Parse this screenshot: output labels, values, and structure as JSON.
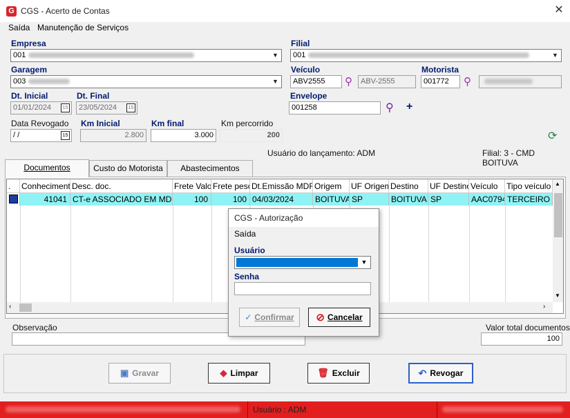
{
  "window": {
    "title": "CGS - Acerto de Contas",
    "app_icon": "G"
  },
  "menu": [
    "Saída",
    "Manutenção de Serviços"
  ],
  "form": {
    "empresa_label": "Empresa",
    "empresa_value": "001",
    "filial_label": "Filial",
    "filial_value": "001",
    "garagem_label": "Garagem",
    "garagem_value": "003",
    "veiculo_label": "Veículo",
    "veiculo_code": "ABV2555",
    "veiculo_plate": "ABV-2555",
    "motorista_label": "Motorista",
    "motorista_code": "001772",
    "dt_inicial_label": "Dt. Inicial",
    "dt_inicial": "01/01/2024",
    "dt_final_label": "Dt. Final",
    "dt_final": "23/05/2024",
    "envelope_label": "Envelope",
    "envelope": "001258",
    "data_revogado_label": "Data Revogado",
    "data_revogado": " /  /",
    "km_inicial_label": "Km Inicial",
    "km_inicial": "2.800",
    "km_final_label": "Km final",
    "km_final": "3.000",
    "km_percorrido_label": "Km percorrido",
    "km_percorrido": "200",
    "cal_glyph": "15",
    "usuario_lancamento": "Usuário do lançamento: ADM",
    "filial_info": "Filial: 3 - CMD BOITUVA"
  },
  "tabs": [
    "Documentos",
    "Custo do Motorista",
    "Abastecimentos"
  ],
  "grid": {
    "headers": [
      ".",
      "Conhecimento",
      "Desc. doc.",
      "Frete Valor",
      "Frete peso",
      "Dt.Emissão MDFe",
      "Origem",
      "UF Origem",
      "Destino",
      "UF Destino",
      "Veículo",
      "Tipo veículo"
    ],
    "row": [
      "",
      "41041",
      "CT-e ASSOCIADO EM MDF-e",
      "100",
      "100",
      "04/03/2024",
      "BOITUVA",
      "SP",
      "BOITUVA",
      "SP",
      "AAC0794",
      "TERCEIRO / A"
    ]
  },
  "observacao_label": "Observação",
  "valor_total_label": "Valor total documentos",
  "valor_total": "100",
  "buttons": {
    "gravar": "Gravar",
    "limpar": "Limpar",
    "excluir": "Excluir",
    "revogar": "Revogar"
  },
  "status": {
    "usuario": "Usuário : ADM"
  },
  "dialog": {
    "title": "CGS - Autorização",
    "menu": "Saída",
    "usuario_label": "Usuário",
    "senha_label": "Senha",
    "confirmar": "Confirmar",
    "cancelar": "Cancelar"
  },
  "colors": {
    "accent": "#0078d7",
    "row_highlight": "#8ff3f5",
    "status_bar": "#e31e1e",
    "label": "#001a6e"
  }
}
